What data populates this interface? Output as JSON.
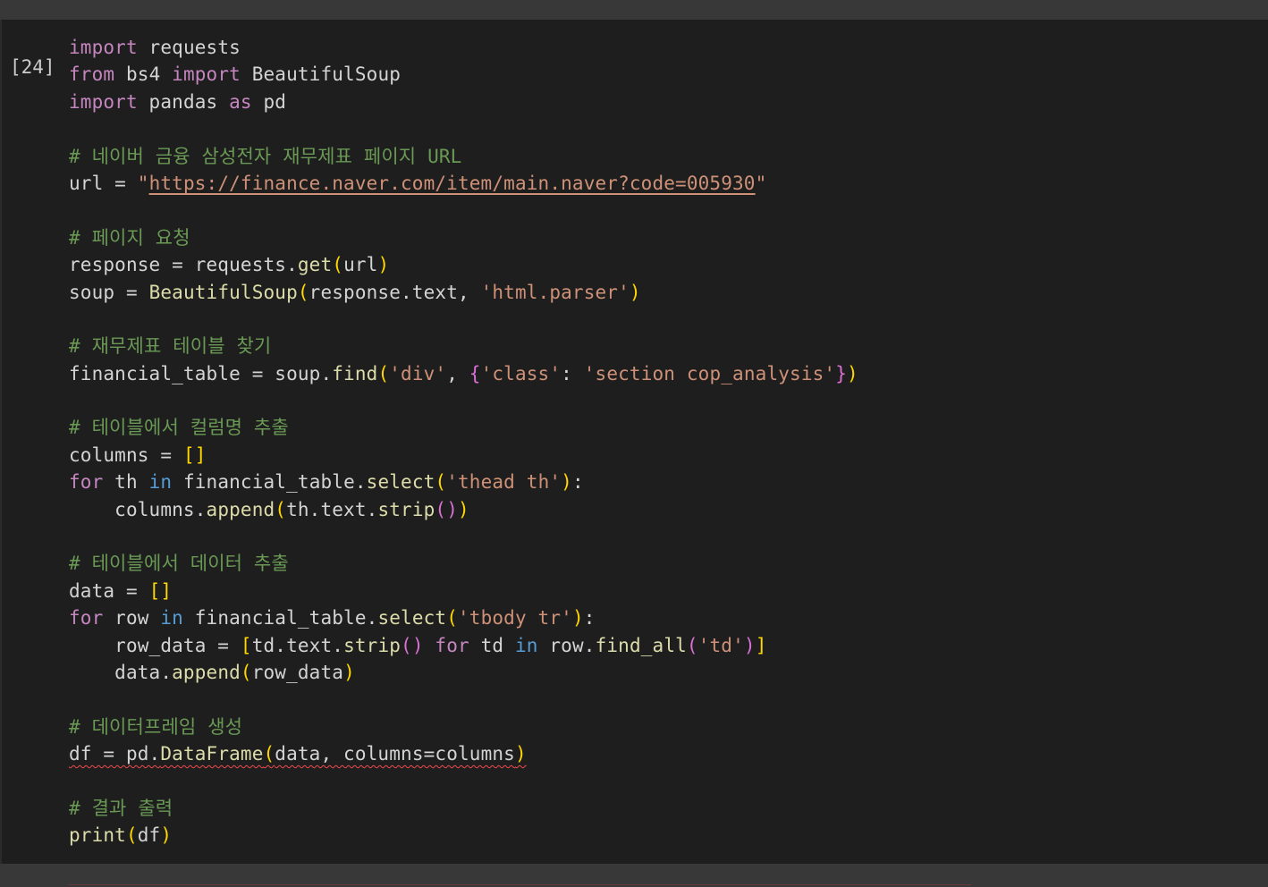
{
  "cell": {
    "execution_count": "[24]",
    "lines": [
      [
        {
          "t": "import",
          "c": "kw"
        },
        {
          "t": " requests"
        }
      ],
      [
        {
          "t": "from",
          "c": "kw"
        },
        {
          "t": " bs4 "
        },
        {
          "t": "import",
          "c": "kw"
        },
        {
          "t": " BeautifulSoup"
        }
      ],
      [
        {
          "t": "import",
          "c": "kw"
        },
        {
          "t": " pandas "
        },
        {
          "t": "as",
          "c": "kw"
        },
        {
          "t": " pd"
        }
      ],
      [],
      [
        {
          "t": "# 네이버 금융 삼성전자 재무제표 페이지 URL",
          "c": "cm"
        }
      ],
      [
        {
          "t": "url = "
        },
        {
          "t": "\"",
          "c": "st"
        },
        {
          "t": "https://finance.naver.com/item/main.naver?code=005930",
          "c": "st link"
        },
        {
          "t": "\"",
          "c": "st"
        }
      ],
      [],
      [
        {
          "t": "# 페이지 요청",
          "c": "cm"
        }
      ],
      [
        {
          "t": "response = requests."
        },
        {
          "t": "get",
          "c": "fn"
        },
        {
          "t": "(",
          "c": "br1"
        },
        {
          "t": "url"
        },
        {
          "t": ")",
          "c": "br1"
        }
      ],
      [
        {
          "t": "soup = "
        },
        {
          "t": "BeautifulSoup",
          "c": "fn"
        },
        {
          "t": "(",
          "c": "br1"
        },
        {
          "t": "response.text, "
        },
        {
          "t": "'html.parser'",
          "c": "st"
        },
        {
          "t": ")",
          "c": "br1"
        }
      ],
      [],
      [
        {
          "t": "# 재무제표 테이블 찾기",
          "c": "cm"
        }
      ],
      [
        {
          "t": "financial_table = soup."
        },
        {
          "t": "find",
          "c": "fn"
        },
        {
          "t": "(",
          "c": "br1"
        },
        {
          "t": "'div'",
          "c": "st"
        },
        {
          "t": ", "
        },
        {
          "t": "{",
          "c": "br2"
        },
        {
          "t": "'class'",
          "c": "st"
        },
        {
          "t": ": "
        },
        {
          "t": "'section cop_analysis'",
          "c": "st"
        },
        {
          "t": "}",
          "c": "br2"
        },
        {
          "t": ")",
          "c": "br1"
        }
      ],
      [],
      [
        {
          "t": "# 테이블에서 컬럼명 추출",
          "c": "cm"
        }
      ],
      [
        {
          "t": "columns = "
        },
        {
          "t": "[]",
          "c": "br1"
        }
      ],
      [
        {
          "t": "for",
          "c": "kw"
        },
        {
          "t": " th "
        },
        {
          "t": "in",
          "c": "in"
        },
        {
          "t": " financial_table."
        },
        {
          "t": "select",
          "c": "fn"
        },
        {
          "t": "(",
          "c": "br1"
        },
        {
          "t": "'thead th'",
          "c": "st"
        },
        {
          "t": ")",
          "c": "br1"
        },
        {
          "t": ":"
        }
      ],
      [
        {
          "t": "    columns."
        },
        {
          "t": "append",
          "c": "fn"
        },
        {
          "t": "(",
          "c": "br1"
        },
        {
          "t": "th.text."
        },
        {
          "t": "strip",
          "c": "fn"
        },
        {
          "t": "()",
          "c": "br2"
        },
        {
          "t": ")",
          "c": "br1"
        }
      ],
      [],
      [
        {
          "t": "# 테이블에서 데이터 추출",
          "c": "cm"
        }
      ],
      [
        {
          "t": "data = "
        },
        {
          "t": "[]",
          "c": "br1"
        }
      ],
      [
        {
          "t": "for",
          "c": "kw"
        },
        {
          "t": " row "
        },
        {
          "t": "in",
          "c": "in"
        },
        {
          "t": " financial_table."
        },
        {
          "t": "select",
          "c": "fn"
        },
        {
          "t": "(",
          "c": "br1"
        },
        {
          "t": "'tbody tr'",
          "c": "st"
        },
        {
          "t": ")",
          "c": "br1"
        },
        {
          "t": ":"
        }
      ],
      [
        {
          "t": "    row_data = "
        },
        {
          "t": "[",
          "c": "br1"
        },
        {
          "t": "td.text."
        },
        {
          "t": "strip",
          "c": "fn"
        },
        {
          "t": "()",
          "c": "br2"
        },
        {
          "t": " "
        },
        {
          "t": "for",
          "c": "kw"
        },
        {
          "t": " td "
        },
        {
          "t": "in",
          "c": "in"
        },
        {
          "t": " row."
        },
        {
          "t": "find_all",
          "c": "fn"
        },
        {
          "t": "(",
          "c": "br2"
        },
        {
          "t": "'td'",
          "c": "st"
        },
        {
          "t": ")",
          "c": "br2"
        },
        {
          "t": "]",
          "c": "br1"
        }
      ],
      [
        {
          "t": "    data."
        },
        {
          "t": "append",
          "c": "fn"
        },
        {
          "t": "(",
          "c": "br1"
        },
        {
          "t": "row_data"
        },
        {
          "t": ")",
          "c": "br1"
        }
      ],
      [],
      [
        {
          "t": "# 데이터프레임 생성",
          "c": "cm"
        }
      ],
      [
        {
          "t": "df = pd.",
          "sq": true
        },
        {
          "t": "DataFrame",
          "c": "fn",
          "sq": true
        },
        {
          "t": "(",
          "c": "br1",
          "sq": true
        },
        {
          "t": "data, columns=columns",
          "sq": true
        },
        {
          "t": ")",
          "c": "br1",
          "sq": true
        }
      ],
      [],
      [
        {
          "t": "# 결과 출력",
          "c": "cm"
        }
      ],
      [
        {
          "t": "print",
          "c": "fn"
        },
        {
          "t": "(",
          "c": "br1"
        },
        {
          "t": "df"
        },
        {
          "t": ")",
          "c": "br1"
        }
      ]
    ]
  }
}
